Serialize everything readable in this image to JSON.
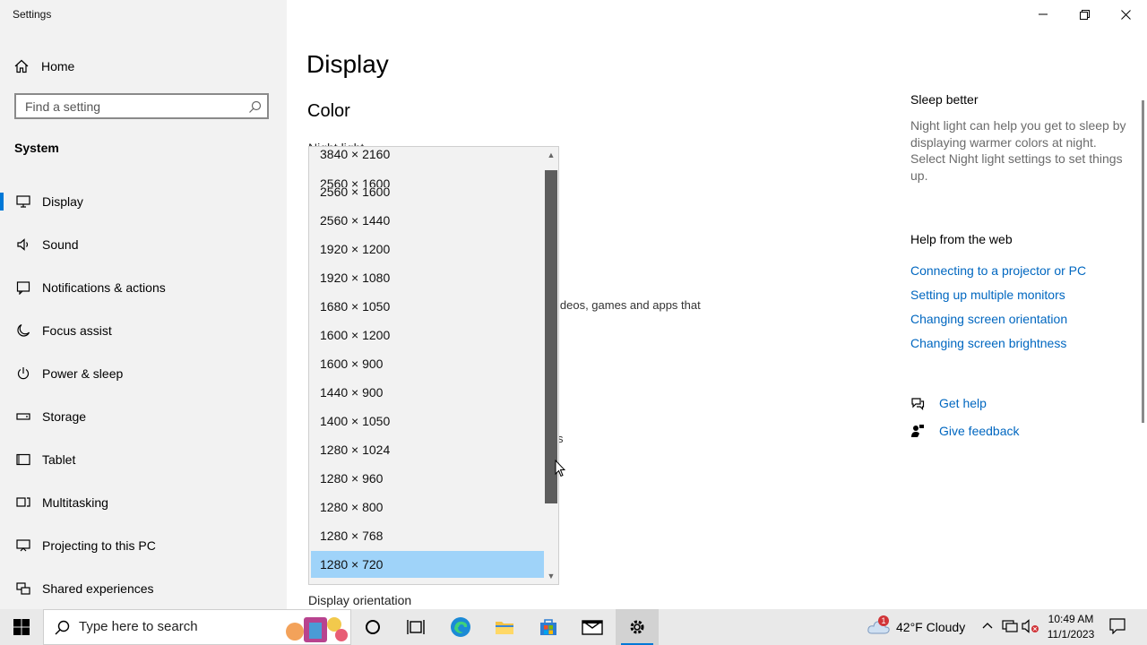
{
  "window": {
    "title": "Settings"
  },
  "sidebar": {
    "home_label": "Home",
    "search_placeholder": "Find a setting",
    "section_title": "System",
    "items": [
      {
        "label": "Display",
        "icon": "monitor-icon",
        "selected": true
      },
      {
        "label": "Sound",
        "icon": "speaker-icon"
      },
      {
        "label": "Notifications & actions",
        "icon": "notification-icon"
      },
      {
        "label": "Focus assist",
        "icon": "moon-icon"
      },
      {
        "label": "Power & sleep",
        "icon": "power-icon"
      },
      {
        "label": "Storage",
        "icon": "drive-icon"
      },
      {
        "label": "Tablet",
        "icon": "tablet-icon"
      },
      {
        "label": "Multitasking",
        "icon": "multitasking-icon"
      },
      {
        "label": "Projecting to this PC",
        "icon": "projector-icon"
      },
      {
        "label": "Shared experiences",
        "icon": "shared-experiences-icon"
      }
    ]
  },
  "main": {
    "title": "Display",
    "color_heading": "Color",
    "night_light_partial": "Night light",
    "hdr_text_partial": "ideos, games and apps that",
    "scale_text_partial": "s",
    "orientation_label": "Display orientation"
  },
  "resolution_dropdown": {
    "options": [
      "3840 × 2160",
      "2560 × 1600",
      "2560 × 1600",
      "2560 × 1440",
      "1920 × 1200",
      "1920 × 1080",
      "1680 × 1050",
      "1600 × 1200",
      "1600 × 900",
      "1440 × 900",
      "1400 × 1050",
      "1280 × 1024",
      "1280 × 960",
      "1280 × 800",
      "1280 × 768",
      "1280 × 720"
    ],
    "selected": "1280 × 720"
  },
  "right_panel": {
    "sleep_heading": "Sleep better",
    "sleep_text": "Night light can help you get to sleep by displaying warmer colors at night. Select Night light settings to set things up.",
    "help_heading": "Help from the web",
    "links": [
      "Connecting to a projector or PC",
      "Setting up multiple monitors",
      "Changing screen orientation",
      "Changing screen brightness"
    ],
    "get_help": "Get help",
    "give_feedback": "Give feedback"
  },
  "taskbar": {
    "search_placeholder": "Type here to search",
    "weather_badge": "1",
    "weather": "42°F  Cloudy",
    "time": "10:49 AM",
    "date": "11/1/2023"
  },
  "colors": {
    "accent": "#0078d7",
    "link": "#0067c0",
    "selection": "#9fd3f9"
  }
}
